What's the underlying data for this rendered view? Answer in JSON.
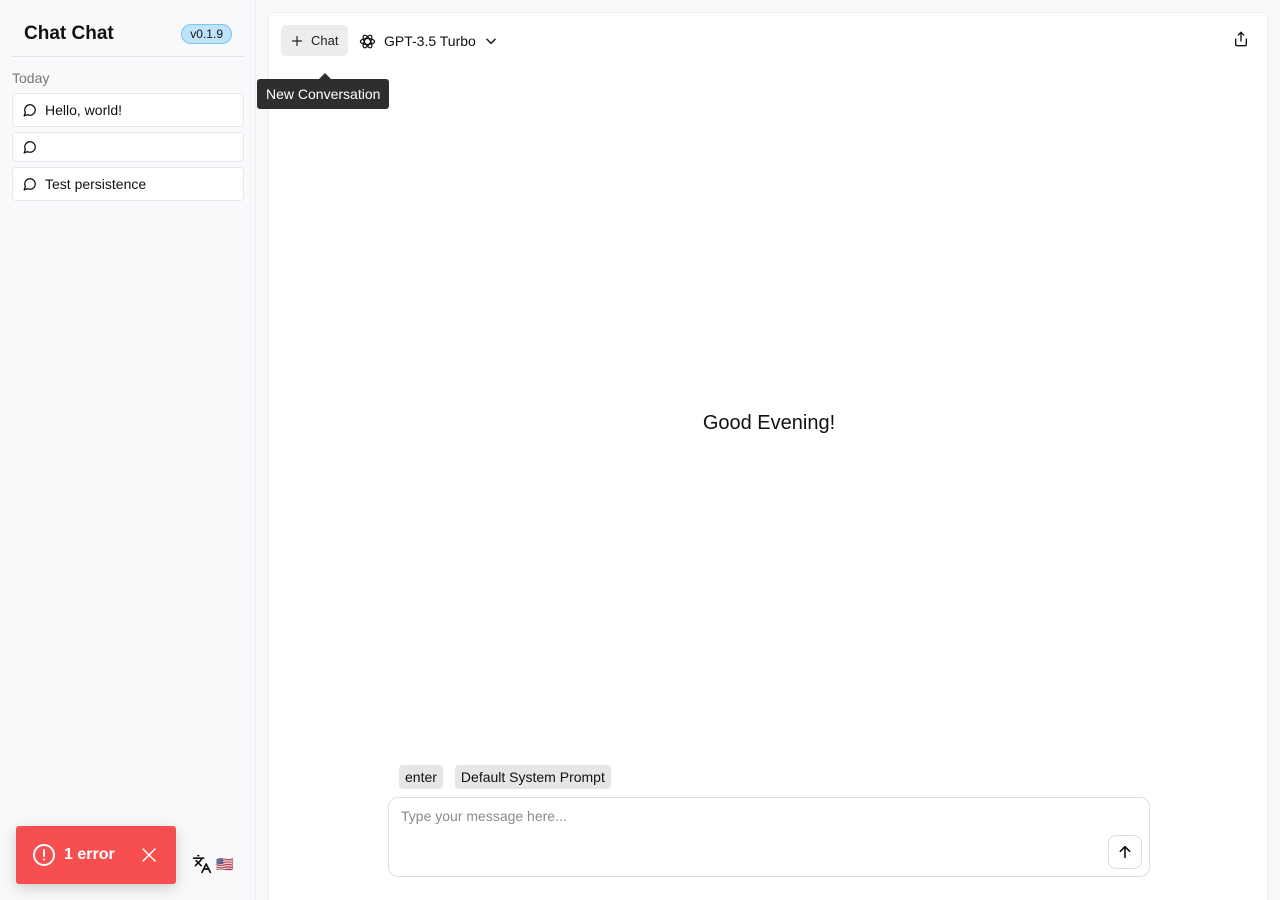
{
  "sidebar": {
    "title": "Chat Chat",
    "version": "v0.1.9",
    "group_label": "Today",
    "conversations": [
      {
        "title": "Hello, world!"
      },
      {
        "title": ""
      },
      {
        "title": "Test persistence"
      }
    ],
    "language_icon": "translate-icon",
    "language_flag": "🇺🇸"
  },
  "toast": {
    "text": "1 error",
    "icon": "alert-circle-icon",
    "color": "#f74f4f"
  },
  "toolbar": {
    "new_chat_label": "Chat",
    "new_chat_tooltip": "New Conversation",
    "model_label": "GPT-3.5 Turbo",
    "model_icon": "openai-icon",
    "share_icon": "share-icon"
  },
  "main": {
    "greeting": "Good Evening!",
    "chips": [
      "enter",
      "Default System Prompt"
    ],
    "input_placeholder": "Type your message here..."
  }
}
